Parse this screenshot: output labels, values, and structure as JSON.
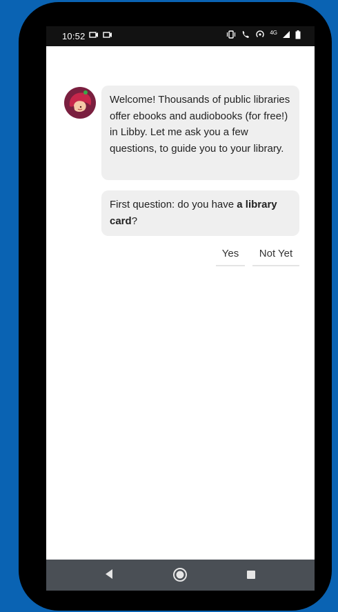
{
  "status_bar": {
    "time": "10:52",
    "network_label": "4G",
    "call_label": "4G"
  },
  "chat": {
    "avatar_icon": "libby-avatar-icon",
    "message1": "Welcome! Thousands of public libraries offer ebooks and audiobooks (for free!) in Libby. Let me ask you a few questions, to guide you to your library.",
    "message2_prefix": "First question: do you have ",
    "message2_bold": "a library card",
    "message2_suffix": "?"
  },
  "choices": {
    "yes": "Yes",
    "not_yet": "Not Yet"
  },
  "nav": {
    "back_icon": "back-triangle-icon",
    "home_icon": "home-circle-icon",
    "recent_icon": "recent-square-icon"
  },
  "colors": {
    "background": "#0a63b3",
    "bubble": "#efefef",
    "navbar": "#4a4f55",
    "avatar": "#7a1f3f"
  }
}
